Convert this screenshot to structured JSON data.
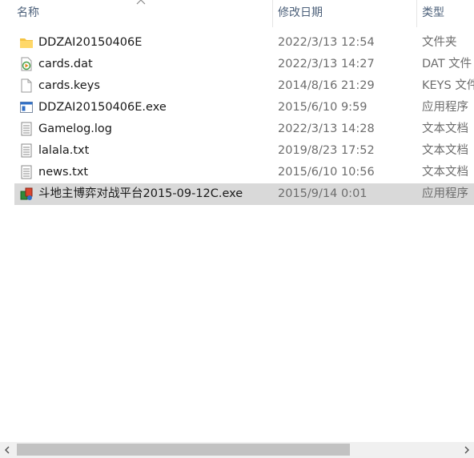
{
  "columns": {
    "name": "名称",
    "date": "修改日期",
    "type": "类型"
  },
  "files": [
    {
      "name": "DDZAI20150406E",
      "date": "2022/3/13 12:54",
      "type": "文件夹",
      "icon": "folder-icon"
    },
    {
      "name": "cards.dat",
      "date": "2022/3/13 14:27",
      "type": "DAT 文件",
      "icon": "media-file-icon"
    },
    {
      "name": "cards.keys",
      "date": "2014/8/16 21:29",
      "type": "KEYS 文件",
      "icon": "blank-file-icon"
    },
    {
      "name": "DDZAI20150406E.exe",
      "date": "2015/6/10 9:59",
      "type": "应用程序",
      "icon": "exe-window-icon"
    },
    {
      "name": "Gamelog.log",
      "date": "2022/3/13 14:28",
      "type": "文本文档",
      "icon": "text-file-icon"
    },
    {
      "name": "lalala.txt",
      "date": "2019/8/23 17:52",
      "type": "文本文档",
      "icon": "text-file-icon"
    },
    {
      "name": "news.txt",
      "date": "2015/6/10 10:56",
      "type": "文本文档",
      "icon": "text-file-icon"
    },
    {
      "name": "斗地主博弈对战平台2015-09-12C.exe",
      "date": "2015/9/14 0:01",
      "type": "应用程序",
      "icon": "app-cards-icon",
      "selected": true
    }
  ],
  "colors": {
    "header_text": "#4c607a",
    "selection": "#d9d9d9",
    "folder": "#f5c342"
  }
}
